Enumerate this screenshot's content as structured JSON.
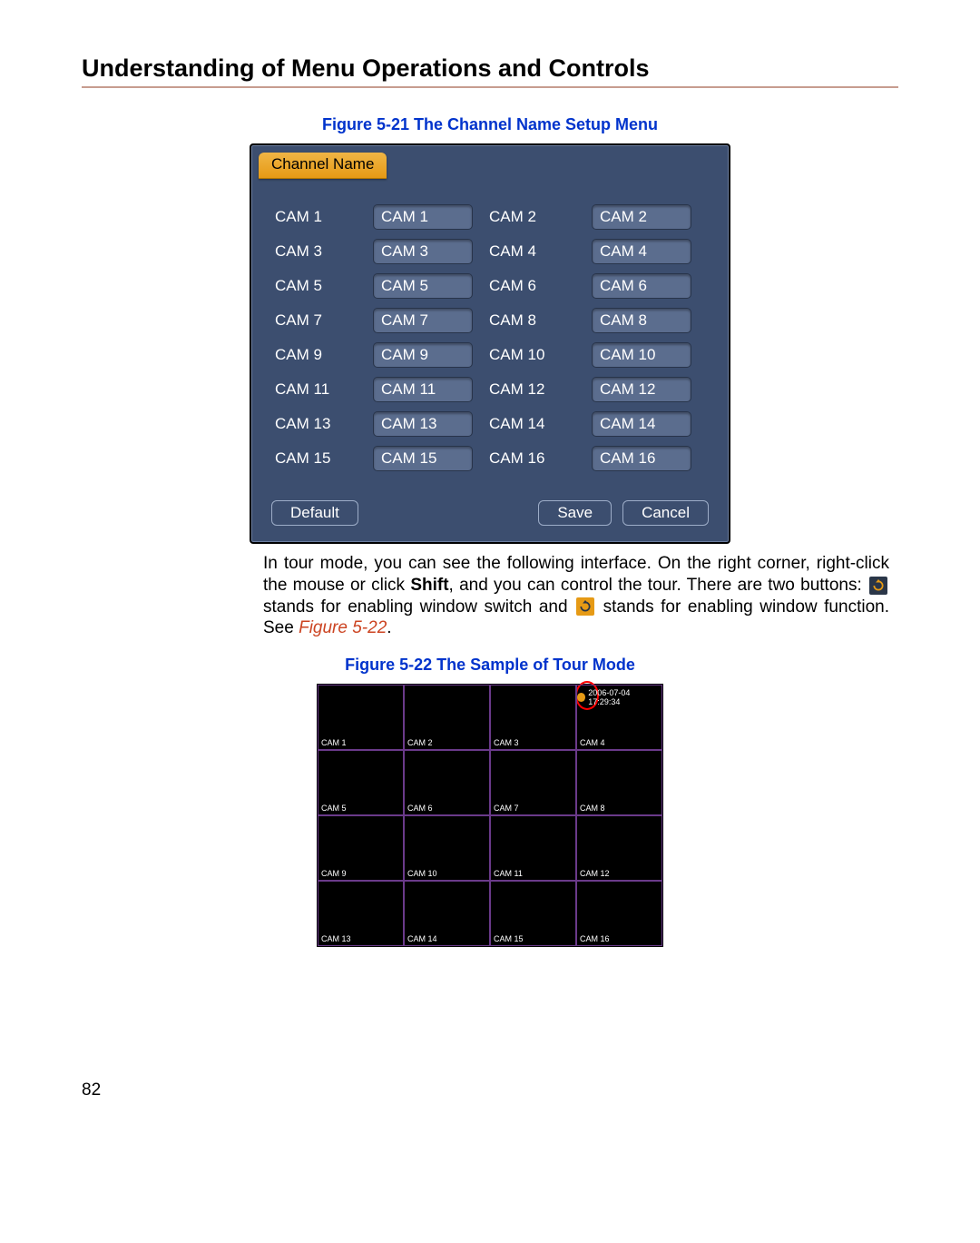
{
  "heading": "Understanding of Menu Operations and Controls",
  "fig1": {
    "caption": "Figure 5-21 The Channel Name Setup Menu",
    "tab": "Channel Name",
    "rows": [
      {
        "l1": "CAM 1",
        "v1": "CAM 1",
        "l2": "CAM 2",
        "v2": "CAM 2"
      },
      {
        "l1": "CAM 3",
        "v1": "CAM 3",
        "l2": "CAM 4",
        "v2": "CAM 4"
      },
      {
        "l1": "CAM 5",
        "v1": "CAM 5",
        "l2": "CAM 6",
        "v2": "CAM 6"
      },
      {
        "l1": "CAM 7",
        "v1": "CAM 7",
        "l2": "CAM 8",
        "v2": "CAM 8"
      },
      {
        "l1": "CAM 9",
        "v1": "CAM 9",
        "l2": "CAM 10",
        "v2": "CAM 10"
      },
      {
        "l1": "CAM 11",
        "v1": "CAM 11",
        "l2": "CAM 12",
        "v2": "CAM 12"
      },
      {
        "l1": "CAM 13",
        "v1": "CAM 13",
        "l2": "CAM 14",
        "v2": "CAM 14"
      },
      {
        "l1": "CAM 15",
        "v1": "CAM 15",
        "l2": "CAM 16",
        "v2": "CAM 16"
      }
    ],
    "buttons": {
      "default": "Default",
      "save": "Save",
      "cancel": "Cancel"
    }
  },
  "para": {
    "t1": "In tour mode, you can see the following interface. On the right corner, right-click the mouse or click ",
    "shift": "Shift",
    "t2": ", and you can control the tour. There are two buttons: ",
    "t3": " stands for enabling window switch and ",
    "t4": " stands for enabling window function. See ",
    "ref": "Figure 5-22",
    "dot": "."
  },
  "fig2": {
    "caption": "Figure 5-22 The Sample of Tour Mode",
    "timestamp": "2006-07-04 17:29:34",
    "cells": [
      "CAM 1",
      "CAM 2",
      "CAM 3",
      "CAM 4",
      "CAM 5",
      "CAM 6",
      "CAM 7",
      "CAM 8",
      "CAM 9",
      "CAM 10",
      "CAM 11",
      "CAM 12",
      "CAM 13",
      "CAM 14",
      "CAM 15",
      "CAM 16"
    ]
  },
  "page_number": "82"
}
